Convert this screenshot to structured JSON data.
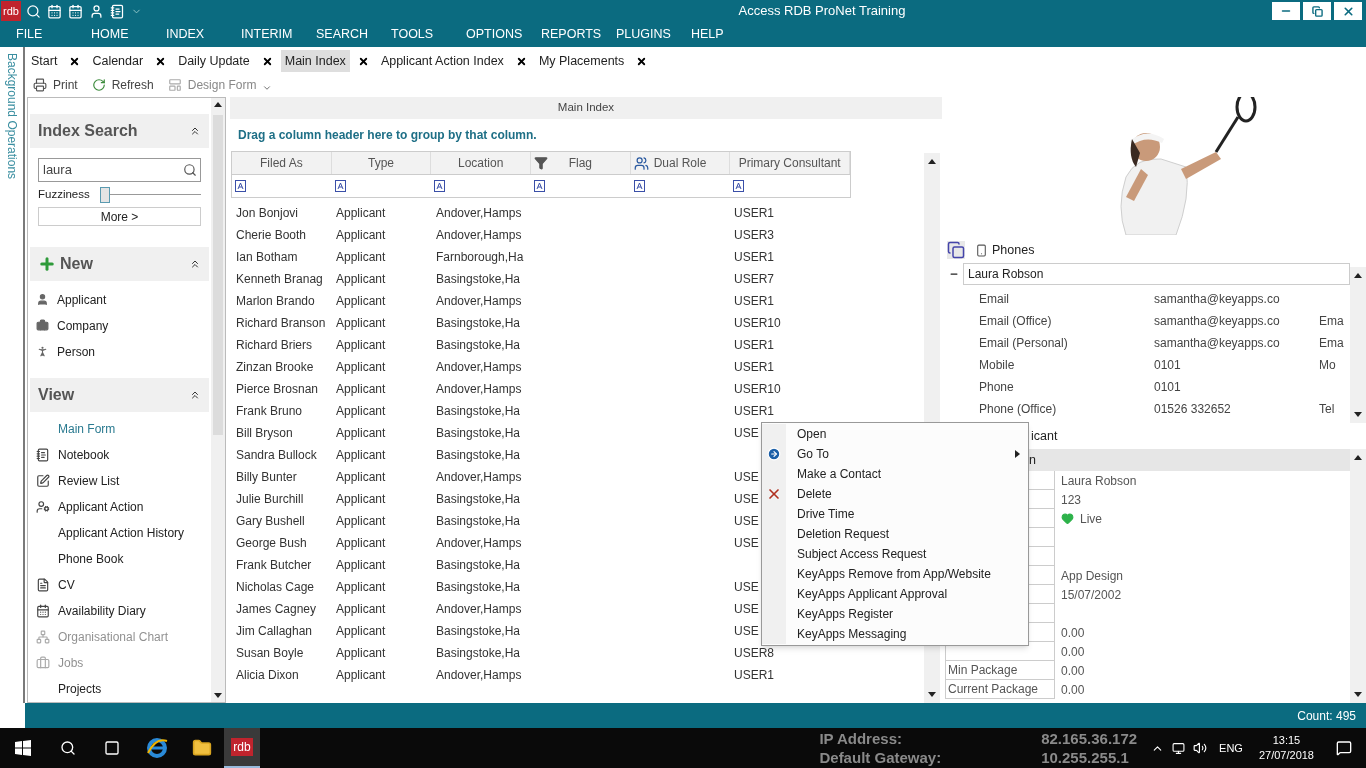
{
  "app": {
    "logo": "rdb",
    "title": "Access RDB ProNet Training"
  },
  "menu": [
    "FILE",
    "HOME",
    "INDEX",
    "INTERIM",
    "SEARCH",
    "TOOLS",
    "OPTIONS",
    "REPORTS",
    "PLUGINS",
    "HELP"
  ],
  "side_tab": "Background Operations",
  "tabs": [
    {
      "label": "Start",
      "selected": false
    },
    {
      "label": "Calendar",
      "selected": false
    },
    {
      "label": "Daily Update",
      "selected": false
    },
    {
      "label": "Main Index",
      "selected": true
    },
    {
      "label": "Applicant Action Index",
      "selected": false
    },
    {
      "label": "My Placements",
      "selected": false
    }
  ],
  "toolbar": [
    {
      "label": "Print",
      "disabled": false
    },
    {
      "label": "Refresh",
      "disabled": false
    },
    {
      "label": "Design Form",
      "disabled": true
    }
  ],
  "index_search": {
    "title": "Index Search",
    "value": "laura",
    "fuzziness_label": "Fuzziness",
    "fuzziness": {
      "level": 0
    },
    "more": "More >"
  },
  "new_section": {
    "title": "New",
    "items": [
      {
        "label": "Applicant"
      },
      {
        "label": "Company"
      },
      {
        "label": "Person"
      }
    ]
  },
  "view_section": {
    "title": "View",
    "items": [
      {
        "label": "Main Form",
        "selected": true,
        "disabled": false
      },
      {
        "label": "Notebook",
        "selected": false,
        "disabled": false
      },
      {
        "label": "Review List",
        "selected": false,
        "disabled": false
      },
      {
        "label": "Applicant Action",
        "selected": false,
        "disabled": false
      },
      {
        "label": "Applicant Action History",
        "selected": false,
        "disabled": false
      },
      {
        "label": "Phone Book",
        "selected": false,
        "disabled": false
      },
      {
        "label": "CV",
        "selected": false,
        "disabled": false
      },
      {
        "label": "Availability Diary",
        "selected": false,
        "disabled": false
      },
      {
        "label": "Organisational Chart",
        "selected": false,
        "disabled": true
      },
      {
        "label": "Jobs",
        "selected": false,
        "disabled": true
      },
      {
        "label": "Projects",
        "selected": false,
        "disabled": false
      }
    ]
  },
  "grid": {
    "title": "Main Index",
    "group_hint": "Drag a column header here to group by that column.",
    "columns": [
      "Filed As",
      "Type",
      "Location",
      "Flag",
      "Dual Role",
      "Primary Consultant"
    ],
    "rows": [
      {
        "filed_as": "Jon Bonjovi",
        "type": "Applicant",
        "location": "Andover,Hamps",
        "consultant": "USER1"
      },
      {
        "filed_as": "Cherie Booth",
        "type": "Applicant",
        "location": "Andover,Hamps",
        "consultant": "USER3"
      },
      {
        "filed_as": "Ian Botham",
        "type": "Applicant",
        "location": "Farnborough,Ha",
        "consultant": "USER1"
      },
      {
        "filed_as": "Kenneth Branag",
        "type": "Applicant",
        "location": "Basingstoke,Ha",
        "consultant": "USER7"
      },
      {
        "filed_as": "Marlon Brando",
        "type": "Applicant",
        "location": "Andover,Hamps",
        "consultant": "USER1"
      },
      {
        "filed_as": "Richard Branson",
        "type": "Applicant",
        "location": "Basingstoke,Ha",
        "consultant": "USER10"
      },
      {
        "filed_as": "Richard Briers",
        "type": "Applicant",
        "location": "Basingstoke,Ha",
        "consultant": "USER1"
      },
      {
        "filed_as": "Zinzan Brooke",
        "type": "Applicant",
        "location": "Andover,Hamps",
        "consultant": "USER1"
      },
      {
        "filed_as": "Pierce Brosnan",
        "type": "Applicant",
        "location": "Andover,Hamps",
        "consultant": "USER10"
      },
      {
        "filed_as": "Frank Bruno",
        "type": "Applicant",
        "location": "Basingstoke,Ha",
        "consultant": "USER1"
      },
      {
        "filed_as": "Bill Bryson",
        "type": "Applicant",
        "location": "Basingstoke,Ha",
        "consultant": "USE"
      },
      {
        "filed_as": "Sandra Bullock",
        "type": "Applicant",
        "location": "Basingstoke,Ha"
      },
      {
        "filed_as": "Billy Bunter",
        "type": "Applicant",
        "location": "Andover,Hamps",
        "consultant": "USE"
      },
      {
        "filed_as": "Julie Burchill",
        "type": "Applicant",
        "location": "Basingstoke,Ha",
        "consultant": "USE"
      },
      {
        "filed_as": "Gary Bushell",
        "type": "Applicant",
        "location": "Basingstoke,Ha",
        "consultant": "USE"
      },
      {
        "filed_as": "George Bush",
        "type": "Applicant",
        "location": "Andover,Hamps",
        "consultant": "USE"
      },
      {
        "filed_as": "Frank Butcher",
        "type": "Applicant",
        "location": "Basingstoke,Ha"
      },
      {
        "filed_as": "Nicholas Cage",
        "type": "Applicant",
        "location": "Basingstoke,Ha",
        "consultant": "USE"
      },
      {
        "filed_as": "James Cagney",
        "type": "Applicant",
        "location": "Andover,Hamps",
        "consultant": "USE"
      },
      {
        "filed_as": "Jim Callaghan",
        "type": "Applicant",
        "location": "Basingstoke,Ha",
        "consultant": "USE"
      },
      {
        "filed_as": "Susan Boyle",
        "type": "Applicant",
        "location": "Basingstoke,Ha",
        "consultant": "USER8"
      },
      {
        "filed_as": "Alicia Dixon",
        "type": "Applicant",
        "location": "Andover,Hamps",
        "consultant": "USER1"
      }
    ]
  },
  "context_menu": {
    "items": [
      {
        "label": "Open",
        "kind": "plain"
      },
      {
        "label": "Go To",
        "kind": "submenu"
      },
      {
        "label": "Make a Contact",
        "kind": "plain"
      },
      {
        "label": "Delete",
        "kind": "delete"
      },
      {
        "label": "Drive Time",
        "kind": "plain"
      },
      {
        "label": "Deletion Request",
        "kind": "plain"
      },
      {
        "label": "Subject Access Request",
        "kind": "plain"
      },
      {
        "label": "KeyApps Remove from App/Website",
        "kind": "plain"
      },
      {
        "label": "KeyApps Applicant Approval",
        "kind": "plain"
      },
      {
        "label": "KeyApps Register",
        "kind": "plain"
      },
      {
        "label": "KeyApps Messaging",
        "kind": "plain"
      }
    ]
  },
  "phones": {
    "title": "Phones",
    "contact": "Laura Robson",
    "expanded": true,
    "rows": [
      {
        "label": "Email",
        "value": "samantha@keyapps.co"
      },
      {
        "label": "Email (Office)",
        "value": "samantha@keyapps.co",
        "type": "Ema"
      },
      {
        "label": "Email (Personal)",
        "value": "samantha@keyapps.co",
        "type": "Ema"
      },
      {
        "label": "Mobile",
        "value": "0101",
        "type": "Mo"
      },
      {
        "label": "Phone",
        "value": "0101"
      },
      {
        "label": "Phone (Office)",
        "value": "01526 332652",
        "type": "Tel"
      }
    ]
  },
  "applicant": {
    "title": "icant",
    "header": "n",
    "rows": [
      {
        "kind": "value",
        "value": "Laura Robson"
      },
      {
        "kind": "value",
        "value": "123"
      },
      {
        "kind": "status",
        "value": "Live",
        "color": "#2db24a"
      },
      {
        "kind": "blank"
      },
      {
        "kind": "blank"
      },
      {
        "kind": "value",
        "value": "App Design"
      },
      {
        "kind": "value",
        "value": "15/07/2002"
      },
      {
        "kind": "blank"
      },
      {
        "kind": "value",
        "value": "0.00"
      },
      {
        "kind": "value",
        "value": "0.00"
      },
      {
        "kind": "value",
        "label": "Min Package",
        "value": "0.00"
      },
      {
        "kind": "value",
        "label": "Current Package",
        "value": "0.00"
      }
    ]
  },
  "status_bar": {
    "count": "Count: 495"
  },
  "taskbar": {
    "app_logo": "rdb",
    "info": [
      {
        "label": "IP Address:",
        "value": "82.165.36.172"
      },
      {
        "label": "Default Gateway:",
        "value": "10.255.255.1"
      }
    ],
    "language": "ENG",
    "time": "13:15",
    "date": "27/07/2018"
  }
}
